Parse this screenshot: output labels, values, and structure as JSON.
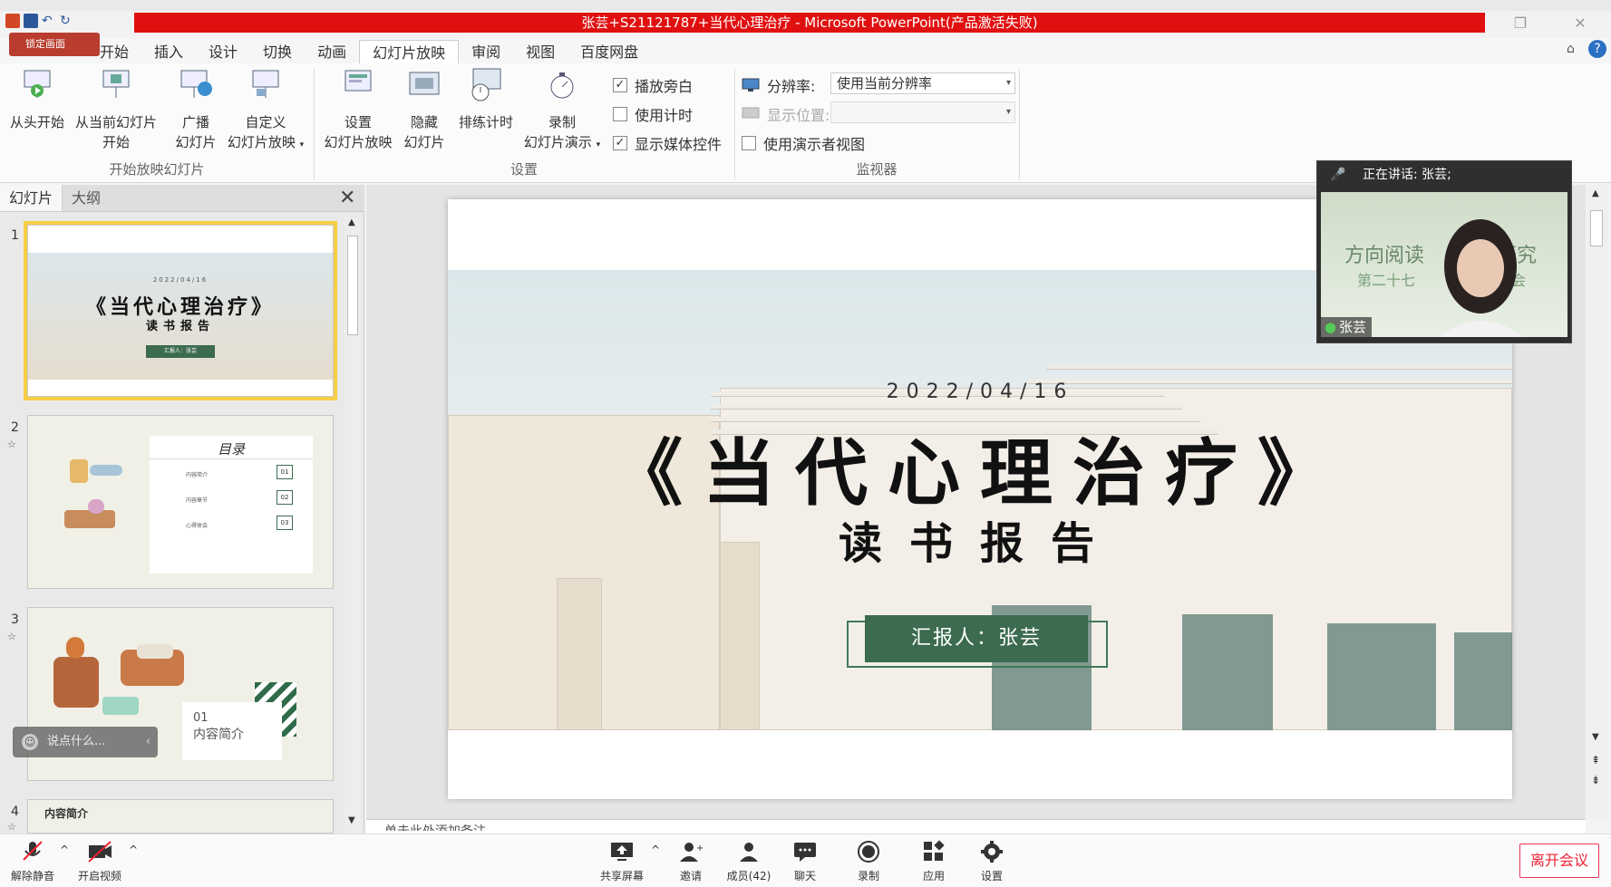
{
  "window": {
    "title": "张芸+S21121787+当代心理治疗 - Microsoft PowerPoint(产品激活失败)",
    "lock_badge": "锁定画面"
  },
  "menu": {
    "tabs": [
      "开始",
      "插入",
      "设计",
      "切换",
      "动画",
      "幻灯片放映",
      "审阅",
      "视图",
      "百度网盘"
    ],
    "active": "幻灯片放映"
  },
  "ribbon": {
    "start_group": {
      "from_beginning": "从头开始",
      "from_current": "从当前幻灯片",
      "from_current_2": "开始",
      "broadcast": "广播",
      "broadcast_2": "幻灯片",
      "custom": "自定义",
      "custom_2": "幻灯片放映",
      "label": "开始放映幻灯片"
    },
    "setup_group": {
      "setup": "设置",
      "setup_2": "幻灯片放映",
      "hide": "隐藏",
      "hide_2": "幻灯片",
      "rehearse": "排练计时",
      "record": "录制",
      "record_2": "幻灯片演示",
      "play_narration": "播放旁白",
      "use_timings": "使用计时",
      "show_media": "显示媒体控件",
      "label": "设置"
    },
    "monitor_group": {
      "resolution_label": "分辨率:",
      "resolution_value": "使用当前分辨率",
      "show_on_label": "显示位置:",
      "presenter_view": "使用演示者视图",
      "label": "监视器"
    }
  },
  "left_pane": {
    "tab_slides": "幻灯片",
    "tab_outline": "大纲",
    "slides": [
      {
        "num": "1",
        "date": "2022/04/16",
        "title": "《当代心理治疗》",
        "subtitle": "读书报告",
        "badge": "汇报人：张芸"
      },
      {
        "num": "2",
        "heading": "目录",
        "items": [
          "内容简介",
          "内容章节",
          "心得体会"
        ],
        "codes": [
          "01",
          "02",
          "03"
        ]
      },
      {
        "num": "3",
        "code": "01",
        "label": "内容简介"
      },
      {
        "num": "4",
        "label": "内容简介"
      }
    ]
  },
  "slide": {
    "date": "2022/04/16",
    "title": "《当代心理治疗》",
    "subtitle": "读书报告",
    "reporter": "汇报人：张芸"
  },
  "notes": {
    "text": "单击此处添加备注"
  },
  "video": {
    "speaking_label": "正在讲话: 张芸;",
    "bg_text_1": "方向阅读",
    "bg_text_1b": "研究",
    "bg_text_2": "第二十七",
    "bg_text_2b": "告会",
    "name": "张芸"
  },
  "chat": {
    "placeholder": "说点什么..."
  },
  "bottom_bar": {
    "unmute": "解除静音",
    "start_video": "开启视频",
    "share_screen": "共享屏幕",
    "invite": "邀请",
    "members": "成员(42)",
    "chat": "聊天",
    "record": "录制",
    "apps": "应用",
    "settings": "设置",
    "leave": "离开会议"
  },
  "colors": {
    "title_red": "#e01010",
    "thumb_selected": "#f7cf46",
    "reporter_green": "#3c6b4f",
    "leave_red": "#e22233"
  }
}
